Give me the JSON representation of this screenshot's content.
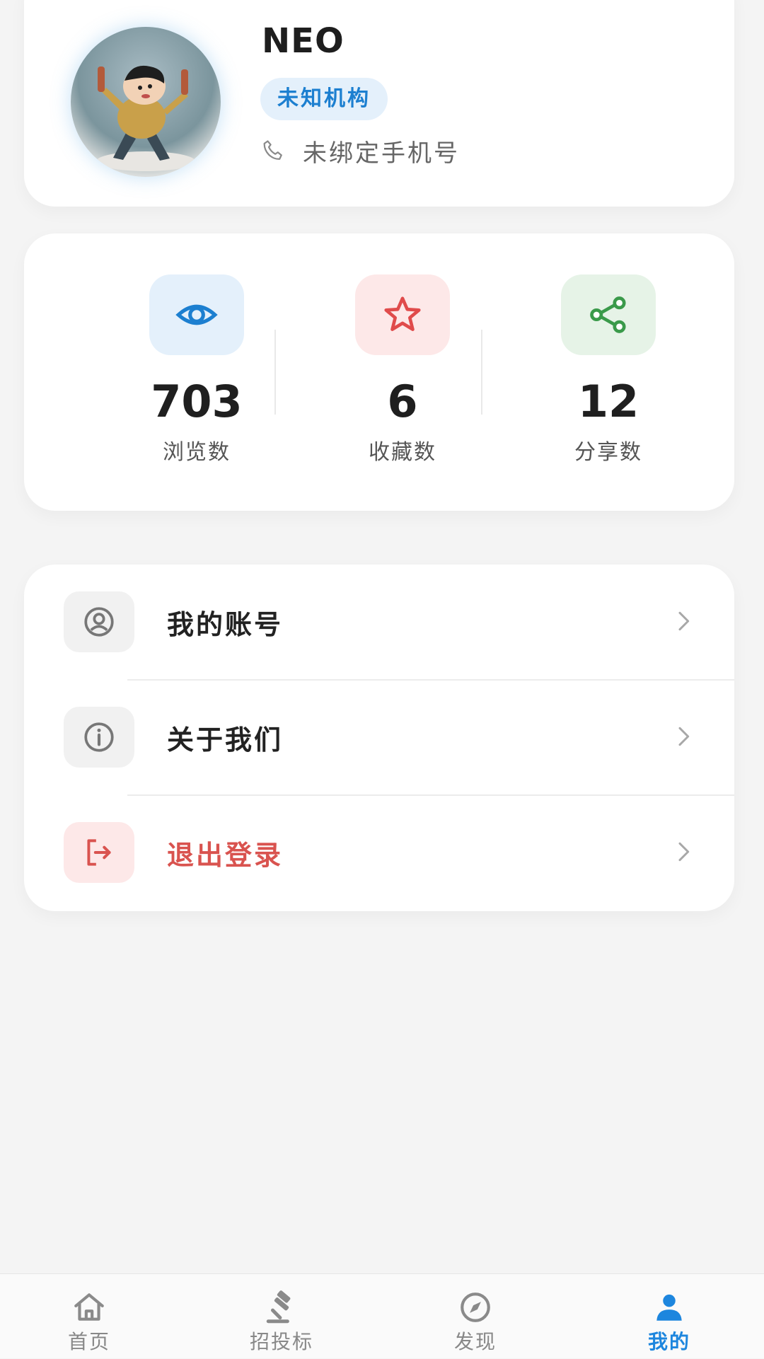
{
  "profile": {
    "name": "NEO",
    "organization": "未知机构",
    "phone_text": "未绑定手机号",
    "avatar_icon": "avatar-image"
  },
  "stats": [
    {
      "icon": "eye-icon",
      "value": "703",
      "label": "浏览数",
      "color": "#1c7fd0",
      "bg": "#e4f0fb"
    },
    {
      "icon": "star-icon",
      "value": "6",
      "label": "收藏数",
      "color": "#e04b4b",
      "bg": "#fde8e8"
    },
    {
      "icon": "share-icon",
      "value": "12",
      "label": "分享数",
      "color": "#3a9a4a",
      "bg": "#e6f3e7"
    }
  ],
  "menu": [
    {
      "icon": "user-circle-icon",
      "label": "我的账号"
    },
    {
      "icon": "info-icon",
      "label": "关于我们"
    },
    {
      "icon": "logout-icon",
      "label": "退出登录",
      "color": "#d9534f"
    }
  ],
  "tabs": [
    {
      "icon": "home-icon",
      "label": "首页",
      "active": false
    },
    {
      "icon": "gavel-icon",
      "label": "招投标",
      "active": false
    },
    {
      "icon": "compass-icon",
      "label": "发现",
      "active": false
    },
    {
      "icon": "person-icon",
      "label": "我的",
      "active": true
    }
  ],
  "colors": {
    "accent": "#1d86de",
    "danger": "#d9534f",
    "background": "#f4f4f4"
  }
}
